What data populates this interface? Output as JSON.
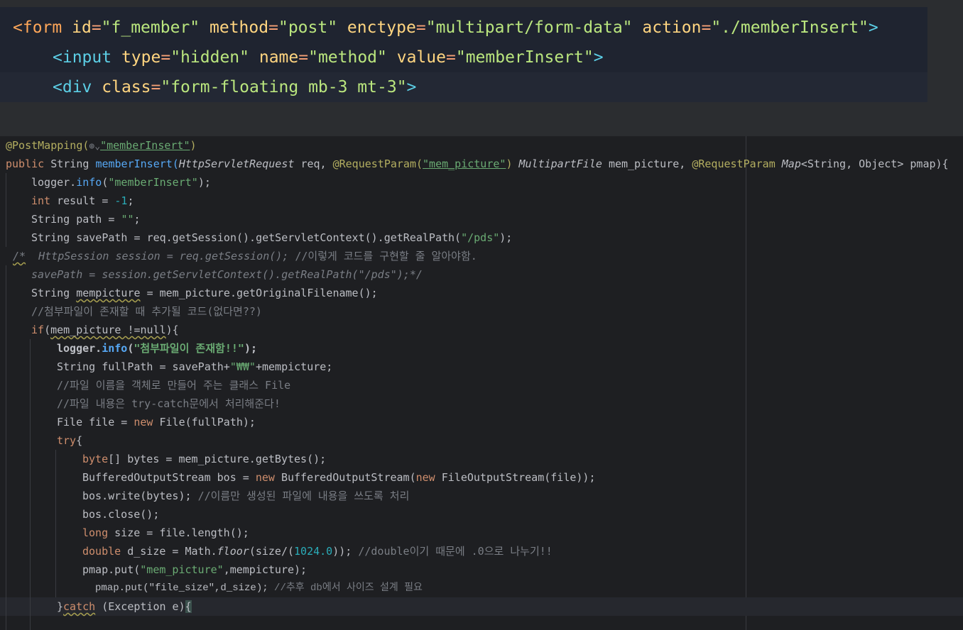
{
  "html_snippet": {
    "line1": {
      "tag_open": "<form",
      "id_attr": "id",
      "id_val": "\"f_member\"",
      "method_attr": "method",
      "method_val": "\"post\"",
      "enctype_attr": "enctype",
      "enctype_val": "\"multipart/form-data\"",
      "action_attr": "action",
      "action_val": "\"./memberInsert\"",
      "close": ">"
    },
    "line2": {
      "tag_open": "<input",
      "type_attr": "type",
      "type_val": "\"hidden\"",
      "name_attr": "name",
      "name_val": "\"method\"",
      "value_attr": "value",
      "value_val": "\"memberInsert\"",
      "close": ">"
    },
    "line3": {
      "tag_open": "<div",
      "class_attr": "class",
      "class_val": "\"form-floating mb-3 mt-3\"",
      "close": ">"
    }
  },
  "java": {
    "l1": {
      "ann": "@PostMapping(",
      "globe": "⊕⌄",
      "path": "\"memberInsert\"",
      "close": ")"
    },
    "l2": {
      "kw_public": "public",
      "t_string": "String",
      "name": "memberInsert(",
      "t_req": "HttpServletRequest",
      "p_req": "req,",
      "ann_rp1": "@RequestParam(",
      "rp1_val": "\"mem_picture\"",
      "rp1_close": ")",
      "t_mpf": "MultipartFile",
      "p_mp": "mem_picture,",
      "ann_rp2": "@RequestParam",
      "t_map": "Map",
      "generic": "<String, Object>",
      "p_pmap": "pmap){"
    },
    "l3": {
      "obj": "logger.",
      "m": "info",
      "open": "(",
      "s": "\"memberInsert\"",
      "close": ");"
    },
    "l4": {
      "kw": "int",
      "v": "result =",
      "n": "-1",
      "end": ";"
    },
    "l5": {
      "t": "String",
      "v": "path =",
      "s": "\"\"",
      "end": ";"
    },
    "l6": {
      "t": "String",
      "v": "savePath =",
      "rest": "req.getSession().getServletContext().getRealPath(",
      "s": "\"/pds\"",
      "end": ");"
    },
    "l7": {
      "cmt_open": "/*",
      "code": "  HttpSession session = req.getSession(); ",
      "note": "//이렇게 코드를 구현할 줄 알아야함."
    },
    "l8": {
      "code": "savePath = session.getServletContext().getRealPath(\"/pds\");*/"
    },
    "l9": {
      "t": "String",
      "v": "mempicture",
      "rest": "= mem_picture.getOriginalFilename();"
    },
    "l10": {
      "cmt": "//첨부파일이 존재할 때 추가될 코드(없다면??)"
    },
    "l11": {
      "kw": "if",
      "open": "(",
      "cond": "mem_picture !=null",
      "close": "){"
    },
    "l12": {
      "obj": "logger.",
      "m": "info",
      "open": "(",
      "s": "\"첨부파일이 존재함!!\"",
      "close": ");"
    },
    "l13": {
      "t": "String",
      "v": "fullPath = savePath+",
      "s": "\"₩₩\"",
      "rest": "+mempicture;"
    },
    "l14": {
      "cmt": "//파일 이름을 객체로 만들어 주는 클래스 File"
    },
    "l15": {
      "cmt": "//파일 내용은 try-catch문에서 처리해준다!"
    },
    "l16": {
      "t": "File",
      "v": "file =",
      "kw": "new",
      "rest": "File(fullPath);"
    },
    "l17": {
      "kw": "try",
      "open": "{"
    },
    "l18": {
      "kw": "byte",
      "rest": "[] bytes = mem_picture.getBytes();"
    },
    "l19": {
      "t": "BufferedOutputStream",
      "v": "bos =",
      "kw1": "new",
      "c1": "BufferedOutputStream(",
      "kw2": "new",
      "c2": "FileOutputStream(file));"
    },
    "l20": {
      "code": "bos.write(bytes); ",
      "cmt": "//이름만 생성된 파일에 내용을 쓰도록 처리"
    },
    "l21": {
      "code": "bos.close();"
    },
    "l22": {
      "kw": "long",
      "v": "size =",
      "rest": "file.length();"
    },
    "l23": {
      "kw": "double",
      "v": "d_size =",
      "cls": "Math.",
      "m": "floor",
      "open": "(size/(",
      "n": "1024.0",
      "close": "));",
      "cmt": "//double이기 때문에 .0으로 나누기!!"
    },
    "l24": {
      "code": "pmap.put(",
      "s": "\"mem_picture\"",
      "rest": ",mempicture);"
    },
    "l25": {
      "code": "pmap.put(\"file_size\",d_size); ",
      "cmt": "//추후 db에서 사이즈 설계 필요"
    },
    "l26": {
      "close": "}",
      "kw": "catch",
      "rest": "(Exception e)",
      "brace": "{"
    }
  }
}
